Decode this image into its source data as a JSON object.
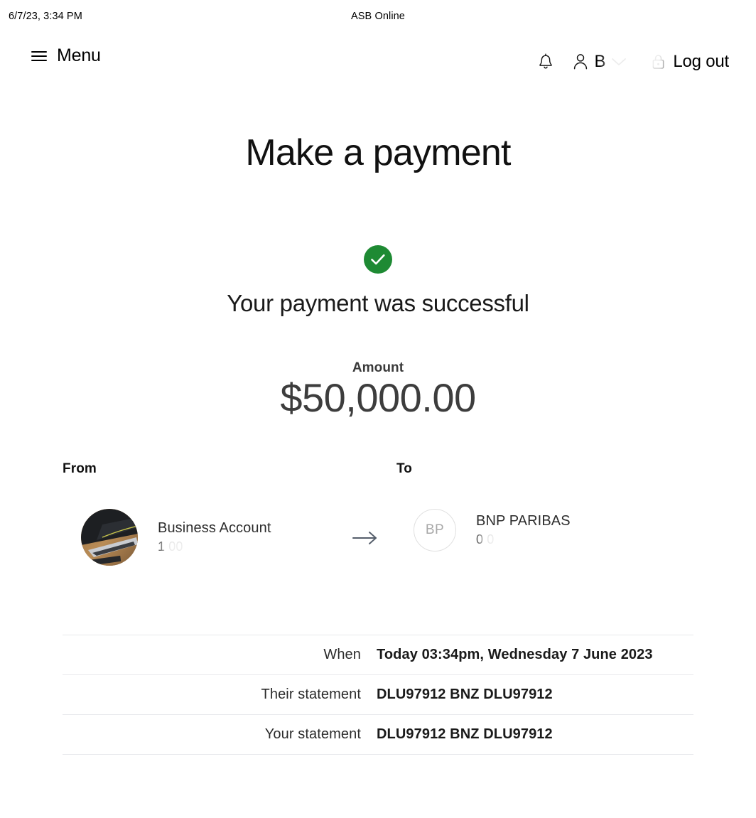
{
  "status_bar": {
    "datetime": "6/7/23, 3:34 PM",
    "document_title": "ASB Online"
  },
  "header": {
    "menu_label": "Menu",
    "notifications_icon": "bell-icon",
    "account_icon": "person-icon",
    "account_name": "B",
    "chevron_icon": "chevron-down-icon",
    "lock_icon": "lock-icon",
    "logout_label": "Log out"
  },
  "page": {
    "title": "Make a payment",
    "success_icon": "check-circle-icon",
    "success_message": "Your payment was successful",
    "success_color": "#1e8a33"
  },
  "amount": {
    "label": "Amount",
    "value": "$50,000.00"
  },
  "transfer": {
    "from_label": "From",
    "to_label": "To",
    "arrow_icon": "arrow-right-icon",
    "from": {
      "avatar_type": "photo",
      "avatar_alt": "laptop-on-desk-photo",
      "name": "Business Account",
      "account_number": "1                    00"
    },
    "to": {
      "avatar_type": "initials",
      "initials": "BP",
      "name": "BNP PARIBAS",
      "account_number": "0                    0"
    }
  },
  "details": {
    "rows": [
      {
        "label": "When",
        "value": "Today 03:34pm, Wednesday 7 June 2023"
      },
      {
        "label": "Their statement",
        "value": "DLU97912 BNZ DLU97912"
      },
      {
        "label": "Your statement",
        "value": "DLU97912 BNZ DLU97912"
      }
    ]
  }
}
